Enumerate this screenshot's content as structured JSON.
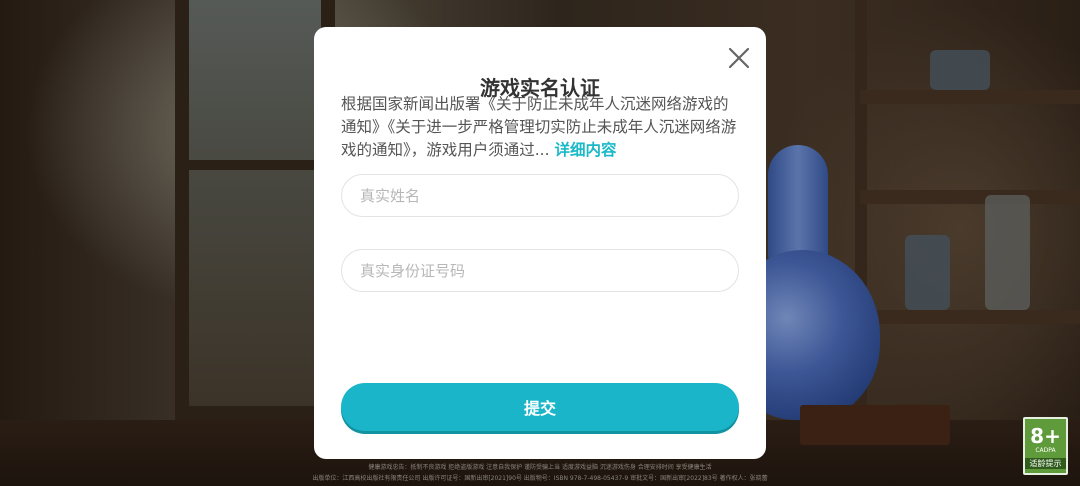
{
  "dialog": {
    "title": "游戏实名认证",
    "notice_text": "根据国家新闻出版署《关于防止未成年人沉迷网络游戏的通知》《关于进一步严格管理切实防止未成年人沉迷网络游戏的通知》，游戏用户须通过...",
    "details_link": "详细内容",
    "name_placeholder": "真实姓名",
    "id_placeholder": "真实身份证号码",
    "name_value": "",
    "id_value": "",
    "submit_label": "提交"
  },
  "footer": {
    "line1": "健康游戏忠告：抵制不良游戏 拒绝盗版游戏 注意自我保护 谨防受骗上当 适度游戏益脑 沉迷游戏伤身 合理安排时间 享受健康生活",
    "line2": "出版单位：江西高校出版社有限责任公司   出版许可证号：国新出审[2021]90号   出版物号：ISBN 978-7-498-05437-9   审批文号：国新出审[2022]83号   著作权人：张晓蕾"
  },
  "age_badge": {
    "rating": "8+",
    "org": "CADPA",
    "tip": "适龄提示"
  },
  "colors": {
    "accent": "#1ab5c8",
    "link": "#1bb9c8",
    "badge_green": "#5f9a3b"
  },
  "icons": {
    "close": "close-icon"
  }
}
